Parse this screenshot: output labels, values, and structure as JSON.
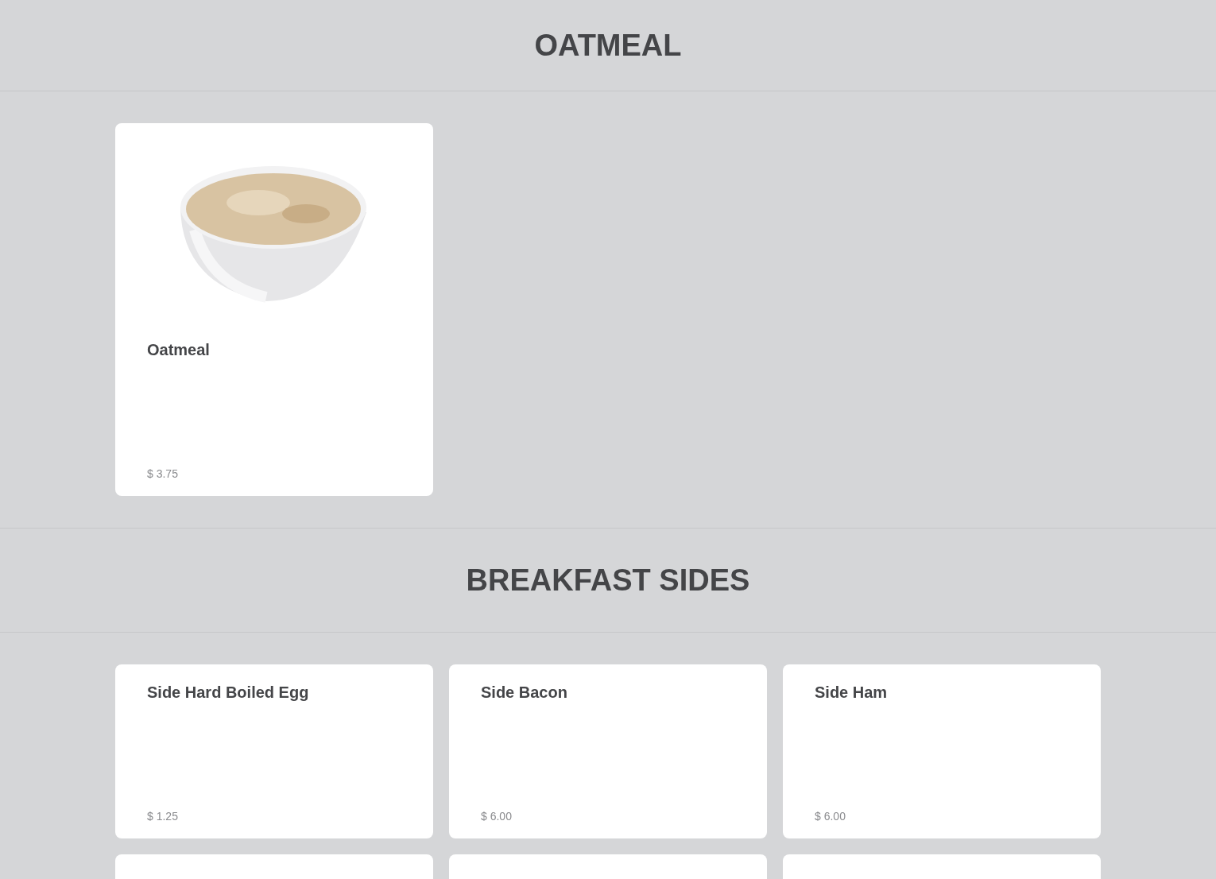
{
  "sections": [
    {
      "title": "OATMEAL",
      "items": [
        {
          "kind": "photo",
          "name": "Oatmeal",
          "price": "$ 3.75"
        }
      ]
    },
    {
      "title": "BREAKFAST SIDES",
      "items": [
        {
          "kind": "plain",
          "name": "Side Hard Boiled Egg",
          "price": "$ 1.25"
        },
        {
          "kind": "plain",
          "name": "Side Bacon",
          "price": "$ 6.00"
        },
        {
          "kind": "plain",
          "name": "Side Ham",
          "price": "$ 6.00"
        },
        {
          "kind": "clipped"
        },
        {
          "kind": "clipped"
        },
        {
          "kind": "clipped"
        }
      ]
    }
  ]
}
